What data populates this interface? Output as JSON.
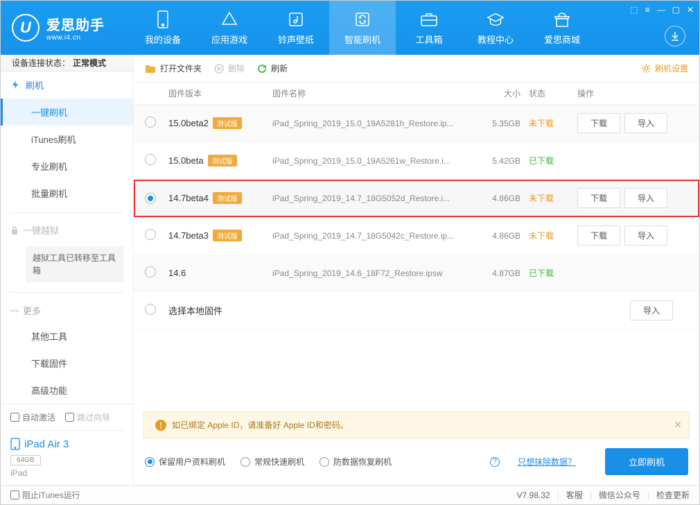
{
  "app": {
    "name": "爱思助手",
    "site": "www.i4.cn"
  },
  "nav": [
    {
      "label": "我的设备"
    },
    {
      "label": "应用游戏"
    },
    {
      "label": "铃声壁纸"
    },
    {
      "label": "智能刷机"
    },
    {
      "label": "工具箱"
    },
    {
      "label": "教程中心"
    },
    {
      "label": "爱思商城"
    }
  ],
  "status": {
    "prefix": "设备连接状态：",
    "mode": "正常模式"
  },
  "sidebar": {
    "cat_flash": "刷机",
    "items": [
      {
        "label": "一键刷机"
      },
      {
        "label": "iTunes刷机"
      },
      {
        "label": "专业刷机"
      },
      {
        "label": "批量刷机"
      }
    ],
    "jailbreak": "一键越狱",
    "jb_moved": "越狱工具已转移至工具箱",
    "more": "更多",
    "more_items": [
      {
        "label": "其他工具"
      },
      {
        "label": "下载固件"
      },
      {
        "label": "高级功能"
      }
    ],
    "auto_activate": "自动激活",
    "skip_guide": "跳过向导",
    "device_name": "iPad Air 3",
    "device_cap": "64GB",
    "device_type": "iPad"
  },
  "toolbar": {
    "open": "打开文件夹",
    "delete": "删除",
    "refresh": "刷新",
    "settings": "刷机设置"
  },
  "table": {
    "head": {
      "version": "固件版本",
      "name": "固件名称",
      "size": "大小",
      "status": "状态",
      "ops": "操作"
    },
    "status_not": "未下载",
    "status_done": "已下载",
    "btn_download": "下载",
    "btn_import": "导入",
    "beta_tag": "测试版",
    "local_label": "选择本地固件",
    "rows": [
      {
        "ver": "15.0beta2",
        "beta": true,
        "name": "iPad_Spring_2019_15.0_19A5281h_Restore.ip...",
        "size": "5.35GB",
        "status": "not",
        "selected": false,
        "ops": true
      },
      {
        "ver": "15.0beta",
        "beta": true,
        "name": "iPad_Spring_2019_15.0_19A5261w_Restore.i...",
        "size": "5.42GB",
        "status": "done",
        "selected": false,
        "ops": false
      },
      {
        "ver": "14.7beta4",
        "beta": true,
        "name": "iPad_Spring_2019_14.7_18G5052d_Restore.i...",
        "size": "4.86GB",
        "status": "not",
        "selected": true,
        "ops": true,
        "hl": true
      },
      {
        "ver": "14.7beta3",
        "beta": true,
        "name": "iPad_Spring_2019_14.7_18G5042c_Restore.ip...",
        "size": "4.86GB",
        "status": "not",
        "selected": false,
        "ops": true
      },
      {
        "ver": "14.6",
        "beta": false,
        "name": "iPad_Spring_2019_14.6_18F72_Restore.ipsw",
        "size": "4.87GB",
        "status": "done",
        "selected": false,
        "ops": false
      }
    ]
  },
  "warn": "如已绑定 Apple ID，请准备好 Apple ID和密码。",
  "options": {
    "keep": "保留用户资料刷机",
    "normal": "常规快速刷机",
    "antierase": "防数据恢复刷机",
    "erase_link": "只想抹除数据？",
    "flash_btn": "立即刷机"
  },
  "footer": {
    "block_itunes": "阻止iTunes运行",
    "version": "V7.98.32",
    "service": "客服",
    "wechat": "微信公众号",
    "update": "检查更新"
  }
}
